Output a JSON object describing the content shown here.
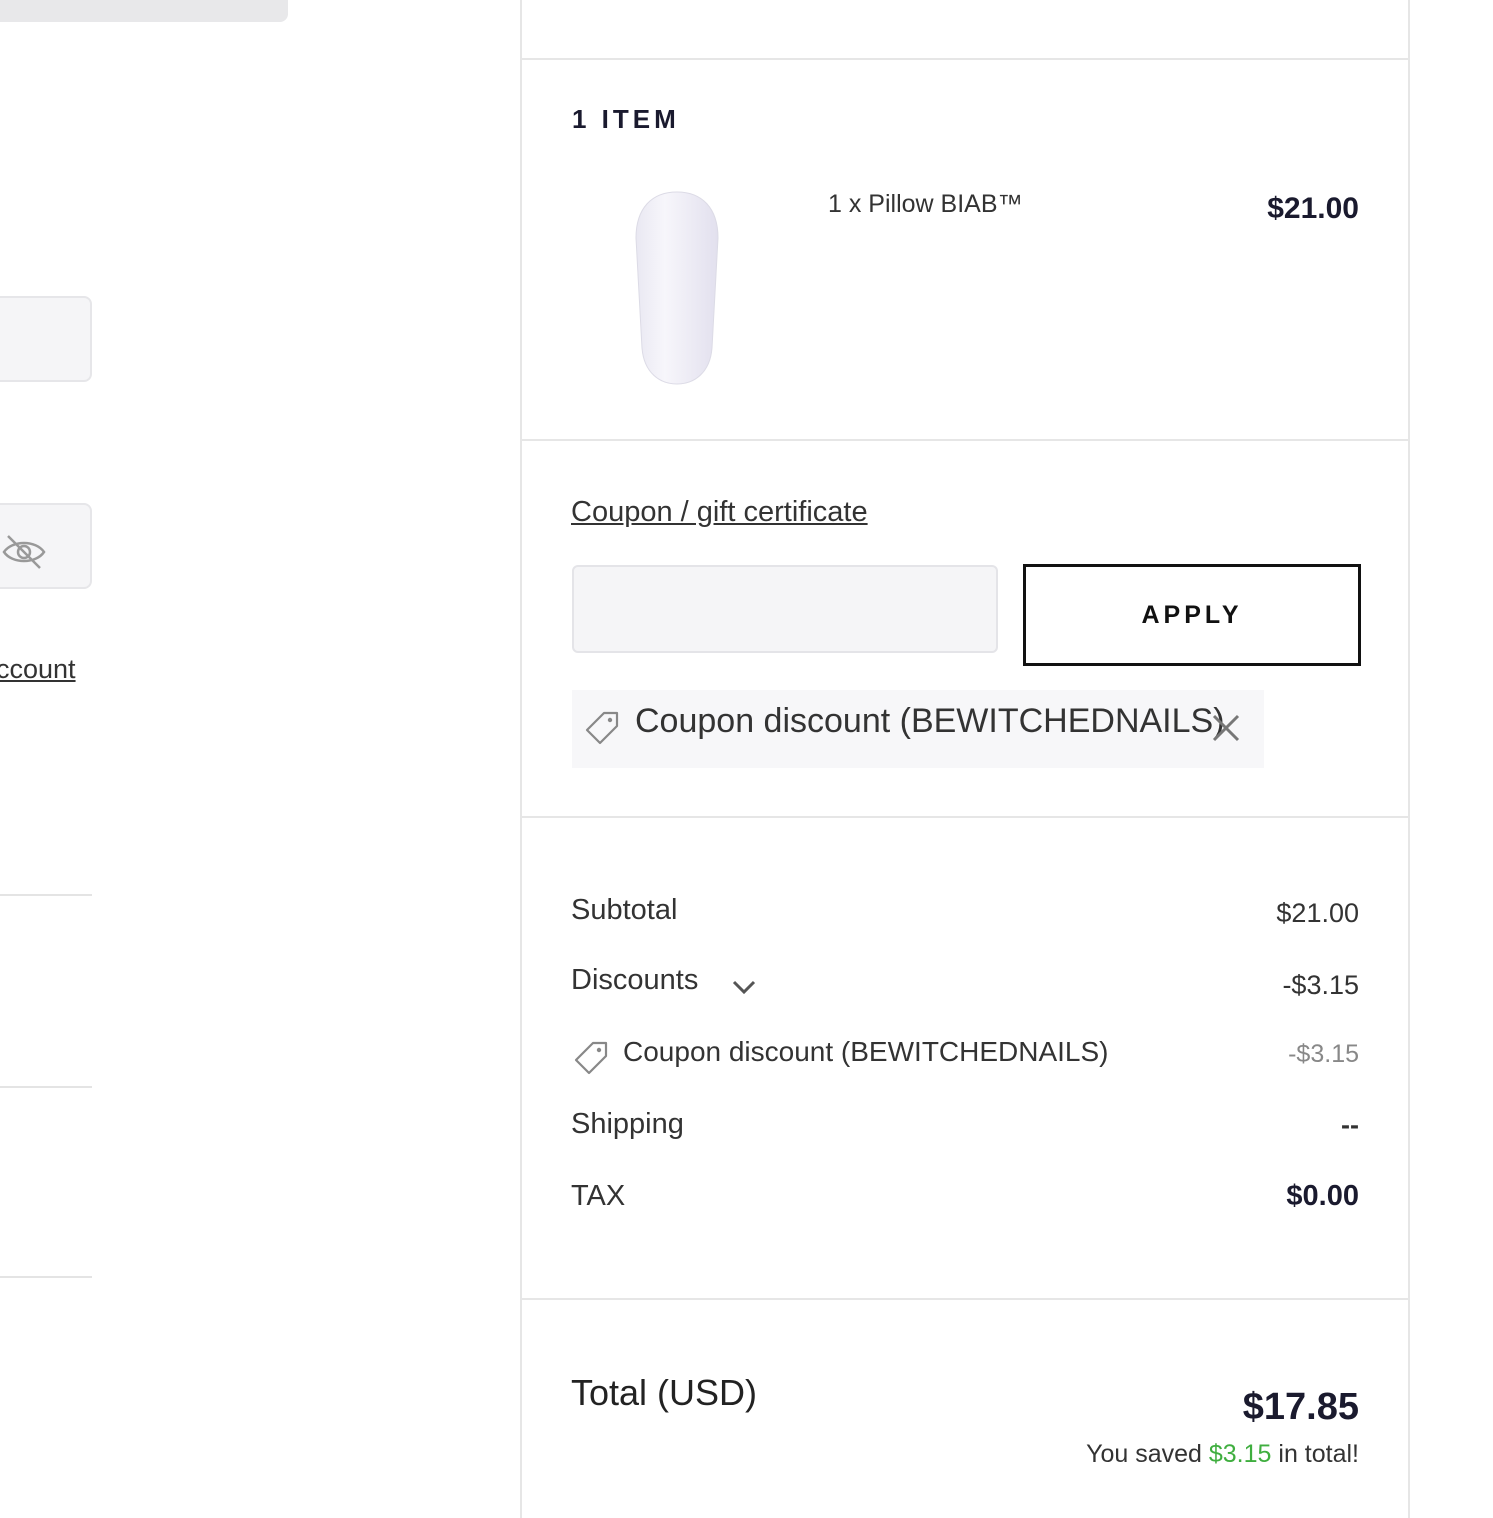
{
  "left": {
    "account_link": "ccount"
  },
  "summary": {
    "items_heading": "1 ITEM",
    "product": {
      "name": "1 x Pillow BIAB™",
      "price": "$21.00"
    },
    "coupon": {
      "link_label": "Coupon / gift certificate",
      "input_value": "",
      "apply_label": "APPLY",
      "applied_label": "Coupon discount (BEWITCHEDNAILS)"
    },
    "rows": {
      "subtotal_label": "Subtotal",
      "subtotal_value": "$21.00",
      "discounts_label": "Discounts",
      "discounts_value": "-$3.15",
      "coupon_label": "Coupon discount (BEWITCHEDNAILS)",
      "coupon_value": "-$3.15",
      "shipping_label": "Shipping",
      "shipping_value": "--",
      "tax_label": "TAX",
      "tax_value": "$0.00"
    },
    "total": {
      "label": "Total (USD)",
      "value": "$17.85",
      "saved_prefix": "You saved",
      "saved_amount": "$3.15",
      "saved_suffix": "in total!"
    }
  },
  "colors": {
    "saved_green": "#3fae3f",
    "divider": "#e6e6e6",
    "input_bg": "#f5f5f7"
  },
  "icons": [
    "eye-slash-icon",
    "tag-icon",
    "close-icon",
    "chevron-down-icon"
  ]
}
